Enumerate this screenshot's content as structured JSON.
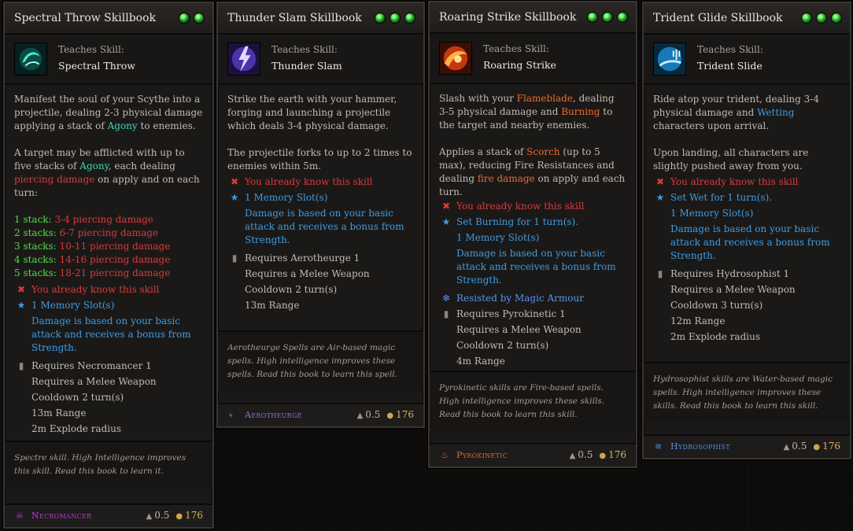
{
  "cards": [
    {
      "title": "Spectral Throw Skillbook",
      "teaches_label": "Teaches Skill:",
      "skill_name": "Spectral Throw",
      "icon": "spectral-throw-icon",
      "desc1_a": "Manifest the soul of your Scythe into a projectile, dealing 2-3 physical damage applying a stack of ",
      "desc1_kw": "Agony",
      "desc1_b": " to enemies.",
      "desc2_a": "A target may be afflicted with up to five stacks of ",
      "desc2_kw": "Agony",
      "desc2_b": ", each dealing ",
      "desc2_kw2": "piercing damage",
      "desc2_c": " on apply and on each turn:",
      "stacks": [
        {
          "label": "1 stack:",
          "value": "3-4 piercing damage"
        },
        {
          "label": "2 stacks:",
          "value": "6-7 piercing damage"
        },
        {
          "label": "3 stacks:",
          "value": "10-11 piercing damage"
        },
        {
          "label": "4 stacks:",
          "value": "14-16 piercing damage"
        },
        {
          "label": "5 stacks:",
          "value": "18-21 piercing damage"
        }
      ],
      "known": "You already know this skill",
      "memory": "1 Memory Slot(s)",
      "scaling": "Damage is based on your basic attack and receives a bonus from Strength.",
      "requires": "Requires Necromancer 1",
      "weapon": "Requires a Melee Weapon",
      "cooldown": "Cooldown  2 turn(s)",
      "range": "13m Range",
      "explode": "2m  Explode radius",
      "flavor": "Spectre skill. High Intelligence improves this skill. Read this book to learn it.",
      "school": "Necromancer",
      "school_color": "#b23ad6",
      "weight": "0.5",
      "gold": "176"
    },
    {
      "title": "Thunder Slam Skillbook",
      "teaches_label": "Teaches Skill:",
      "skill_name": "Thunder Slam",
      "icon": "thunder-slam-icon",
      "desc1": "Strike the earth with your hammer, forging and launching a projectile which deals 3-4 physical damage.",
      "desc2": "The projectile forks to up to 2 times to enemies within 5m.",
      "known": "You already know this skill",
      "memory": "1 Memory Slot(s)",
      "scaling": "Damage is based on your basic attack and receives a bonus from Strength.",
      "requires": "Requires Aerotheurge 1",
      "weapon": "Requires a Melee Weapon",
      "cooldown": "Cooldown  2 turn(s)",
      "range": "13m Range",
      "flavor": "Aerotheurge Spells are Air-based magic spells. High intelligence improves these spells. Read this book to learn this spell.",
      "school": "Aerotheurge",
      "school_color": "#8a72e0",
      "weight": "0.5",
      "gold": "176"
    },
    {
      "title": "Roaring Strike Skillbook",
      "teaches_label": "Teaches Skill:",
      "skill_name": "Roaring Strike",
      "icon": "roaring-strike-icon",
      "desc1_a": "Slash with your ",
      "desc1_kw": "Flameblade",
      "desc1_b": ", dealing 3-5 physical damage and ",
      "desc1_kw2": "Burning",
      "desc1_c": " to the target and nearby enemies.",
      "desc2_a": "Applies a stack of ",
      "desc2_kw": "Scorch",
      "desc2_b": " (up to 5 max), reducing Fire Resistances and dealing ",
      "desc2_kw2": "fire damage",
      "desc2_c": " on apply and each turn.",
      "known": "You already know this skill",
      "effect": "Set Burning for 1 turn(s).",
      "memory": "1 Memory Slot(s)",
      "scaling": "Damage is based on your basic attack and receives a bonus from Strength.",
      "resisted": "Resisted by Magic Armour",
      "requires": "Requires Pyrokinetic 1",
      "weapon": "Requires a Melee Weapon",
      "cooldown": "Cooldown  2 turn(s)",
      "range": "4m  Range",
      "flavor": "Pyrokinetic skills are Fire-based spells. High intelligence improves these skills. Read this book to learn this skill.",
      "school": "Pyrokinetic",
      "school_color": "#e0653a",
      "weight": "0.5",
      "gold": "176"
    },
    {
      "title": "Trident Glide Skillbook",
      "teaches_label": "Teaches Skill:",
      "skill_name": "Trident Slide",
      "icon": "trident-glide-icon",
      "desc1_a": "Ride atop your trident, dealing 3-4 physical damage and ",
      "desc1_kw": "Wetting",
      "desc1_b": " characters upon arrival.",
      "desc2": "Upon landing, all characters are slightly pushed away from you.",
      "known": "You already know this skill",
      "effect": "Set Wet for 1 turn(s).",
      "memory": "1 Memory Slot(s)",
      "scaling": "Damage is based on your basic attack and receives a bonus from Strength.",
      "requires": "Requires Hydrosophist 1",
      "weapon": "Requires a Melee Weapon",
      "cooldown": "Cooldown  3 turn(s)",
      "range": "12m  Range",
      "explode": "2m  Explode radius",
      "flavor": "Hydrosophist skills are Water-based magic spells. High intelligence improves these skills. Read this book to learn this skill.",
      "school": "Hydrosophist",
      "school_color": "#4d8fe0",
      "weight": "0.5",
      "gold": "176"
    }
  ]
}
